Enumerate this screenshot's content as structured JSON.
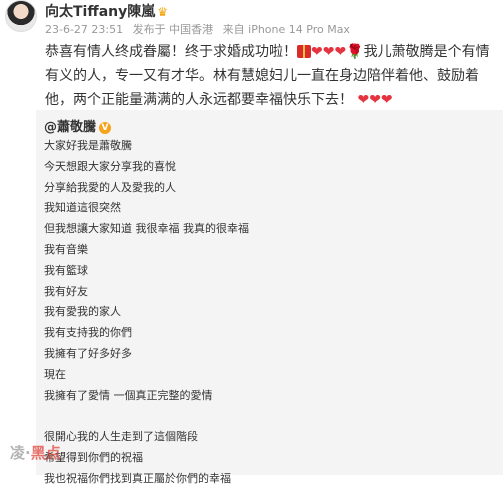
{
  "header": {
    "username": "向太Tiffany陳嵐",
    "date": "23-6-27 23:51",
    "location": "发布于 中国香港",
    "source": "来自 iPhone 14 Pro Max"
  },
  "post": {
    "text_1": "恭喜有情人终成眷屬！终于求婚成功啦！",
    "text_2": "我儿萧敬腾是个有情有义的人，专一又有才华。林有慧媳妇儿一直在身边陪伴着他、鼓励着他，两个正能量满满的人永远都要幸福快乐下去！"
  },
  "repost": {
    "author": "@蕭敬騰",
    "lines": [
      "大家好我是蕭敬騰",
      "今天想跟大家分享我的喜悅",
      "分享給我愛的人及愛我的人",
      "我知道這很突然",
      "但我想讓大家知道 我很幸福 我真的很幸福",
      "我有音樂",
      "我有籃球",
      "我有好友",
      "我有愛我的家人",
      "我有支持我的你們",
      "我擁有了好多好多",
      "現在",
      "我擁有了愛情 一個真正完整的愛情",
      "",
      "很開心我的人生走到了這個階段",
      "希望得到你們的祝福",
      "我也祝福你們找到真正屬於你們的幸福"
    ]
  },
  "watermark": {
    "part1": "凌·",
    "part2": "黑点"
  },
  "icons": [
    "crown-icon",
    "verified-badge-icon",
    "heart-icon",
    "gift-icon",
    "rose-icon"
  ],
  "colors": {
    "heart": "#e5343f",
    "badge": "#f7a21b",
    "repost_bg": "#f4f4f4",
    "meta": "#999999"
  }
}
